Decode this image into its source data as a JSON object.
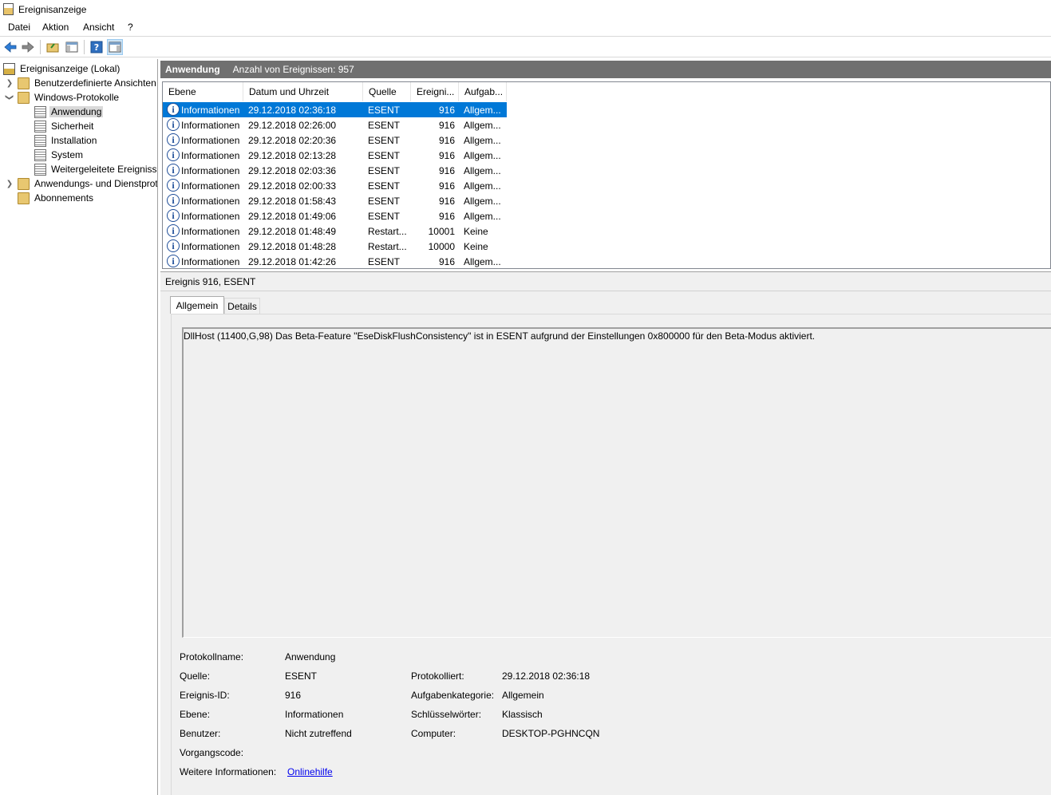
{
  "window": {
    "title": "Ereignisanzeige"
  },
  "menu": [
    "Datei",
    "Aktion",
    "Ansicht",
    "?"
  ],
  "toolbar": {
    "icons": [
      "back-arrow-icon",
      "forward-arrow-icon",
      "open-folder-icon",
      "show-hide-tree-icon",
      "help-icon",
      "show-hide-actions-icon"
    ]
  },
  "tree": {
    "root": "Ereignisanzeige (Lokal)",
    "custom_views": "Benutzerdefinierte Ansichten",
    "windows_logs": "Windows-Protokolle",
    "logs": [
      "Anwendung",
      "Sicherheit",
      "Installation",
      "System",
      "Weitergeleitete Ereignisse"
    ],
    "app_services": "Anwendungs- und Dienstprotokolle",
    "subscriptions": "Abonnements"
  },
  "pane": {
    "title": "Anwendung",
    "count": "Anzahl von Ereignissen: 957"
  },
  "columns": [
    "Ebene",
    "Datum und Uhrzeit",
    "Quelle",
    "Ereigni...",
    "Aufgab..."
  ],
  "events": [
    {
      "level": "Informationen",
      "datetime": "29.12.2018 02:36:18",
      "source": "ESENT",
      "id": "916",
      "task": "Allgem..."
    },
    {
      "level": "Informationen",
      "datetime": "29.12.2018 02:26:00",
      "source": "ESENT",
      "id": "916",
      "task": "Allgem..."
    },
    {
      "level": "Informationen",
      "datetime": "29.12.2018 02:20:36",
      "source": "ESENT",
      "id": "916",
      "task": "Allgem..."
    },
    {
      "level": "Informationen",
      "datetime": "29.12.2018 02:13:28",
      "source": "ESENT",
      "id": "916",
      "task": "Allgem..."
    },
    {
      "level": "Informationen",
      "datetime": "29.12.2018 02:03:36",
      "source": "ESENT",
      "id": "916",
      "task": "Allgem..."
    },
    {
      "level": "Informationen",
      "datetime": "29.12.2018 02:00:33",
      "source": "ESENT",
      "id": "916",
      "task": "Allgem..."
    },
    {
      "level": "Informationen",
      "datetime": "29.12.2018 01:58:43",
      "source": "ESENT",
      "id": "916",
      "task": "Allgem..."
    },
    {
      "level": "Informationen",
      "datetime": "29.12.2018 01:49:06",
      "source": "ESENT",
      "id": "916",
      "task": "Allgem..."
    },
    {
      "level": "Informationen",
      "datetime": "29.12.2018 01:48:49",
      "source": "Restart...",
      "id": "10001",
      "task": "Keine"
    },
    {
      "level": "Informationen",
      "datetime": "29.12.2018 01:48:28",
      "source": "Restart...",
      "id": "10000",
      "task": "Keine"
    },
    {
      "level": "Informationen",
      "datetime": "29.12.2018 01:42:26",
      "source": "ESENT",
      "id": "916",
      "task": "Allgem..."
    }
  ],
  "detail": {
    "title": "Ereignis 916, ESENT",
    "tabs": [
      "Allgemein",
      "Details"
    ],
    "description": "DllHost (11400,G,98) Das Beta-Feature \"EseDiskFlushConsistency\" ist in ESENT aufgrund der Einstellungen 0x800000 für den Beta-Modus aktiviert.",
    "labels": {
      "log_name": "Protokollname:",
      "source": "Quelle:",
      "event_id": "Ereignis-ID:",
      "level": "Ebene:",
      "user": "Benutzer:",
      "opcode": "Vorgangscode:",
      "more_info": "Weitere Informationen:",
      "logged": "Protokolliert:",
      "task_category": "Aufgabenkategorie:",
      "keywords": "Schlüsselwörter:",
      "computer": "Computer:"
    },
    "values": {
      "log_name": "Anwendung",
      "source": "ESENT",
      "event_id": "916",
      "level": "Informationen",
      "user": "Nicht zutreffend",
      "more_info_link": "Onlinehilfe",
      "logged": "29.12.2018 02:36:18",
      "task_category": "Allgemein",
      "keywords": "Klassisch",
      "computer": "DESKTOP-PGHNCQN"
    }
  }
}
